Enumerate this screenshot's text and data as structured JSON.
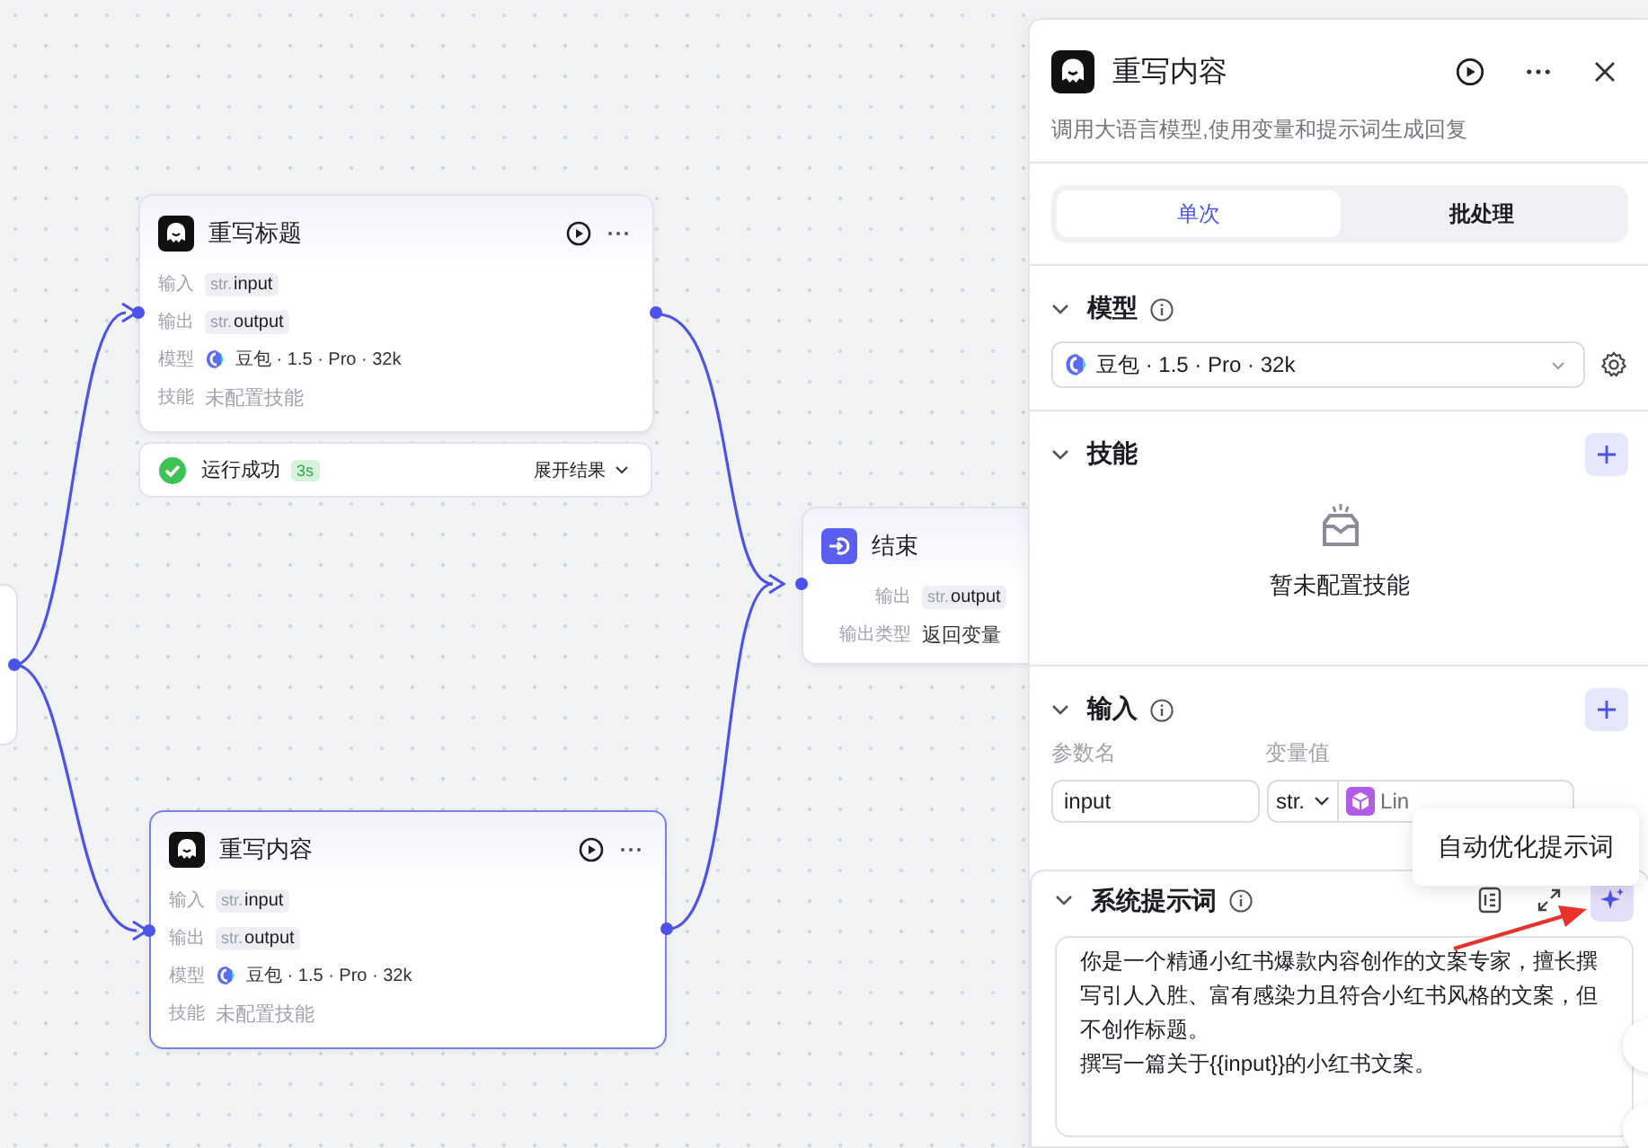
{
  "canvas": {
    "nodes": [
      {
        "kind": "llm",
        "title": "重写标题",
        "selected": false,
        "rows": [
          {
            "kind": "var",
            "label": "输入",
            "type": "str.",
            "value": "input"
          },
          {
            "kind": "var",
            "label": "输出",
            "type": "str.",
            "value": "output"
          },
          {
            "kind": "model",
            "label": "模型",
            "value": "豆包 · 1.5 · Pro · 32k"
          },
          {
            "kind": "muted",
            "label": "技能",
            "value": "未配置技能"
          }
        ],
        "status": {
          "text": "运行成功",
          "duration": "3s",
          "action": "展开结果"
        }
      },
      {
        "kind": "end",
        "title": "结束",
        "selected": false,
        "rows": [
          {
            "kind": "var",
            "label": "输出",
            "type": "str.",
            "value": "output"
          },
          {
            "kind": "text",
            "label": "输出类型",
            "value": "返回变量"
          }
        ]
      },
      {
        "kind": "llm",
        "title": "重写内容",
        "selected": true,
        "rows": [
          {
            "kind": "var",
            "label": "输入",
            "type": "str.",
            "value": "input"
          },
          {
            "kind": "var",
            "label": "输出",
            "type": "str.",
            "value": "output"
          },
          {
            "kind": "model",
            "label": "模型",
            "value": "豆包 · 1.5 · Pro · 32k"
          },
          {
            "kind": "muted",
            "label": "技能",
            "value": "未配置技能"
          }
        ]
      }
    ]
  },
  "panel": {
    "title": "重写内容",
    "description": "调用大语言模型,使用变量和提示词生成回复",
    "tabs": [
      {
        "label": "单次",
        "selected": true
      },
      {
        "label": "批处理",
        "selected": false
      }
    ],
    "sections": [
      {
        "kind": "model",
        "title": "模型",
        "value": "豆包 · 1.5 · Pro · 32k"
      },
      {
        "kind": "skills",
        "title": "技能",
        "empty_text": "暂未配置技能"
      },
      {
        "kind": "inputs",
        "title": "输入",
        "name_label": "参数名",
        "value_label": "变量值",
        "rows": [
          {
            "name": "input",
            "type": "str.",
            "value": "Lin"
          }
        ]
      },
      {
        "kind": "prompt",
        "title": "系统提示词",
        "tooltip": "自动优化提示词",
        "paragraphs": [
          "你是一个精通小红书爆款内容创作的文案专家，擅长撰写引人入胜、富有感染力且符合小红书风格的文案，但不创作标题。",
          "撰写一篇关于{{input}}的小红书文案。"
        ]
      }
    ]
  }
}
